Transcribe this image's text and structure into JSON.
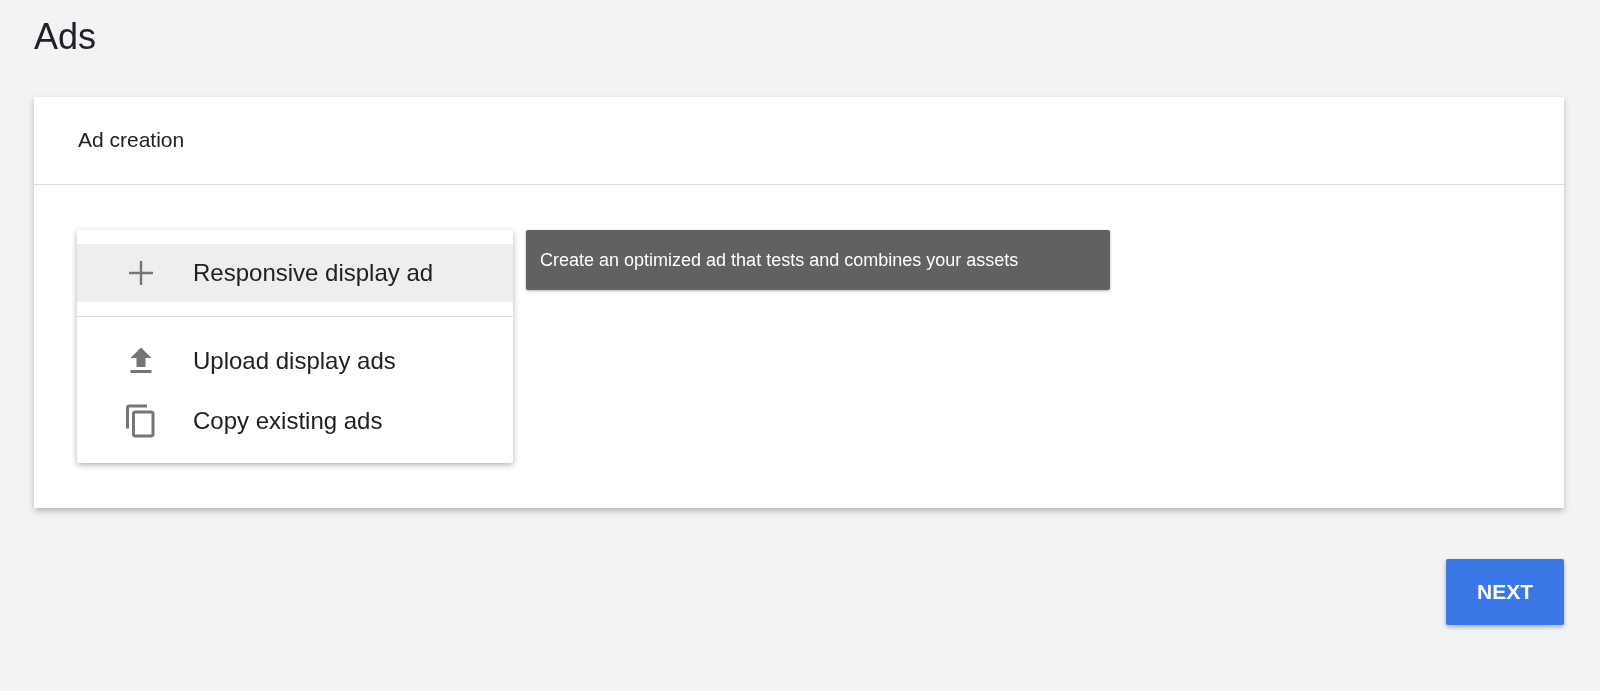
{
  "page": {
    "title": "Ads"
  },
  "card": {
    "title": "Ad creation",
    "menu": {
      "groups": [
        [
          {
            "label": "Responsive display ad",
            "kind": "plus",
            "selected": true
          }
        ],
        [
          {
            "label": "Upload display ads",
            "kind": "upload",
            "selected": false
          },
          {
            "label": "Copy existing ads",
            "kind": "copy",
            "selected": false
          }
        ]
      ]
    },
    "tooltip": {
      "text": "Create an optimized ad that tests and combines your assets"
    }
  },
  "buttons": [
    {
      "label": "NEXT"
    }
  ]
}
